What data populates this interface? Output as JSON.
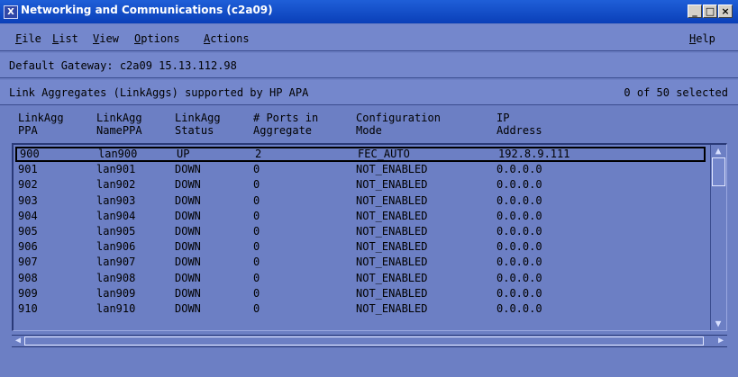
{
  "window": {
    "title": "Networking and Communications (c2a09)",
    "icon_label": "X",
    "controls": {
      "minimize": "_",
      "maximize": "□",
      "close": "×"
    }
  },
  "menu": {
    "file": {
      "accel": "F",
      "rest": "ile"
    },
    "list": {
      "accel": "L",
      "rest": "ist"
    },
    "view": {
      "accel": "V",
      "rest": "iew"
    },
    "options": {
      "accel": "O",
      "rest": "ptions"
    },
    "actions": {
      "accel": "A",
      "rest": "ctions"
    },
    "help": {
      "accel": "H",
      "rest": "elp"
    }
  },
  "gateway": {
    "text": "Default Gateway: c2a09  15.13.112.98"
  },
  "section": {
    "title": "Link Aggregates (LinkAggs) supported by HP APA",
    "selection_status": "0 of 50 selected"
  },
  "columns": [
    "LinkAgg\nPPA",
    "LinkAgg\nNamePPA",
    "LinkAgg\nStatus",
    "# Ports in\nAggregate",
    "Configuration\nMode",
    "IP\nAddress"
  ],
  "rows": [
    [
      "900",
      "lan900",
      "UP",
      "2",
      "FEC_AUTO",
      "192.8.9.111"
    ],
    [
      "901",
      "lan901",
      "DOWN",
      "0",
      "NOT_ENABLED",
      "0.0.0.0"
    ],
    [
      "902",
      "lan902",
      "DOWN",
      "0",
      "NOT_ENABLED",
      "0.0.0.0"
    ],
    [
      "903",
      "lan903",
      "DOWN",
      "0",
      "NOT_ENABLED",
      "0.0.0.0"
    ],
    [
      "904",
      "lan904",
      "DOWN",
      "0",
      "NOT_ENABLED",
      "0.0.0.0"
    ],
    [
      "905",
      "lan905",
      "DOWN",
      "0",
      "NOT_ENABLED",
      "0.0.0.0"
    ],
    [
      "906",
      "lan906",
      "DOWN",
      "0",
      "NOT_ENABLED",
      "0.0.0.0"
    ],
    [
      "907",
      "lan907",
      "DOWN",
      "0",
      "NOT_ENABLED",
      "0.0.0.0"
    ],
    [
      "908",
      "lan908",
      "DOWN",
      "0",
      "NOT_ENABLED",
      "0.0.0.0"
    ],
    [
      "909",
      "lan909",
      "DOWN",
      "0",
      "NOT_ENABLED",
      "0.0.0.0"
    ],
    [
      "910",
      "lan910",
      "DOWN",
      "0",
      "NOT_ENABLED",
      "0.0.0.0"
    ]
  ],
  "focused_row": "900",
  "colors": {
    "background": "#6c7fc4",
    "titlebar": "#0a3fb8",
    "title_text": "#ffffff"
  },
  "icons": {
    "scroll_up": "up-arrow-icon",
    "scroll_down": "down-arrow-icon",
    "scroll_left": "left-arrow-icon",
    "scroll_right": "right-arrow-icon"
  }
}
